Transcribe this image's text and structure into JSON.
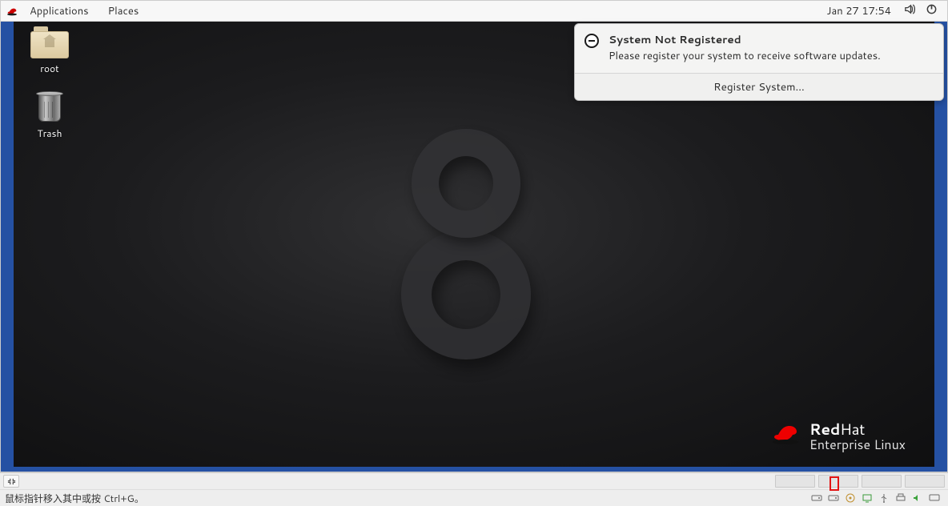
{
  "topbar": {
    "menus": {
      "applications": "Applications",
      "places": "Places"
    },
    "clock": "Jan 27  17:54"
  },
  "desktop": {
    "icons": {
      "root_label": "root",
      "trash_label": "Trash"
    },
    "brand": {
      "line1a": "Red",
      "line1b": "Hat",
      "line2": "Enterprise Linux"
    }
  },
  "notification": {
    "title": "System Not Registered",
    "message": "Please register your system to receive software updates.",
    "action": "Register System…"
  },
  "vm_bottom": {
    "hint": "鼠标指针移入其中或按 Ctrl+G。"
  }
}
